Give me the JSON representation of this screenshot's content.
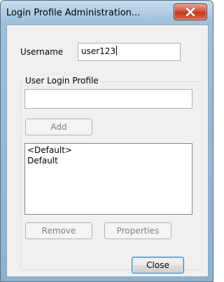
{
  "window": {
    "title": "Login Profile Administration...",
    "close_icon": "close-icon"
  },
  "username": {
    "label": "Username",
    "value": "user123"
  },
  "profile_group": {
    "legend": "User Login Profile",
    "input_value": "",
    "add_label": "Add",
    "list_items": [
      "<Default>",
      "Default"
    ],
    "remove_label": "Remove",
    "properties_label": "Properties"
  },
  "footer": {
    "close_label": "Close"
  }
}
